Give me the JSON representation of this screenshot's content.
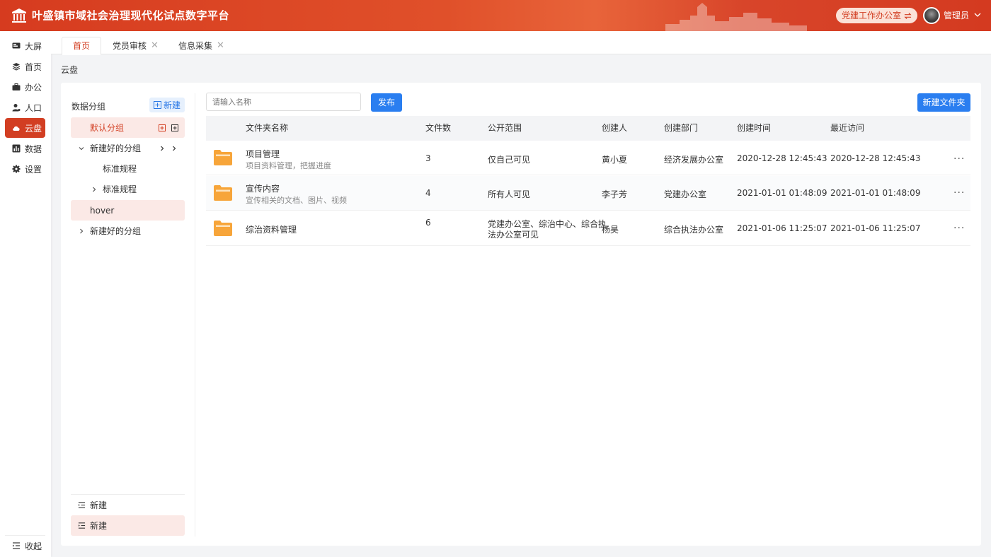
{
  "header": {
    "title": "叶盛镇市域社会治理现代化试点数字平台",
    "switch_label": "党建工作办公室",
    "switch_icon": "swap-icon",
    "user_name": "管理员"
  },
  "sidebar": {
    "items": [
      {
        "label": "大屏",
        "icon": "screen-icon"
      },
      {
        "label": "首页",
        "icon": "layers-icon"
      },
      {
        "label": "办公",
        "icon": "briefcase-icon"
      },
      {
        "label": "人口",
        "icon": "person-icon"
      },
      {
        "label": "云盘",
        "icon": "cloud-icon",
        "active": true
      },
      {
        "label": "数据",
        "icon": "chart-icon"
      },
      {
        "label": "设置",
        "icon": "gear-icon"
      }
    ],
    "collapse_label": "收起"
  },
  "tabs": [
    {
      "label": "首页",
      "active": true
    },
    {
      "label": "党员审核"
    },
    {
      "label": "信息采集"
    }
  ],
  "breadcrumb": "云盘",
  "groups": {
    "title": "数据分组",
    "new_label": "新建",
    "items": [
      {
        "label": "默认分组"
      },
      {
        "label": "新建好的分组"
      },
      {
        "label": "标准规程"
      },
      {
        "label": "标准规程"
      },
      {
        "label": "hover"
      },
      {
        "label": "新建好的分组"
      }
    ],
    "bottom_items": [
      {
        "label": "新建"
      },
      {
        "label": "新建"
      }
    ]
  },
  "toolbar": {
    "search_placeholder": "请输入名称",
    "publish_label": "发布",
    "new_folder_label": "新建文件夹"
  },
  "table": {
    "columns": [
      "文件夹名称",
      "文件数",
      "公开范围",
      "创建人",
      "创建部门",
      "创建时间",
      "最近访问"
    ],
    "rows": [
      {
        "name": "项目管理",
        "desc": "项目资料管理，把握进度",
        "count": "3",
        "scope_1": "仅自己可见",
        "scope_2": "",
        "creator": "黄小夏",
        "dept": "经济发展办公室",
        "created": "2020-12-28 12:45:43",
        "visited": "2020-12-28 12:45:43"
      },
      {
        "name": "宣传内容",
        "desc": "宣传相关的文档、图片、视频",
        "count": "4",
        "scope_1": "所有人可见",
        "scope_2": "",
        "creator": "李子芳",
        "dept": "党建办公室",
        "created": "2021-01-01 01:48:09",
        "visited": "2021-01-01 01:48:09"
      },
      {
        "name": "综治资料管理",
        "desc": "",
        "count": "6",
        "scope_1": "党建办公室、综治中心、综合执",
        "scope_2": "法办公室可见",
        "creator": "杨昊",
        "dept": "综合执法办公室",
        "created": "2021-01-06 11:25:07",
        "visited": "2021-01-06 11:25:07"
      }
    ],
    "more_label": "···"
  },
  "colors": {
    "brand": "#d23e22",
    "primary": "#2a7ef0",
    "folder": "#f7a53a"
  }
}
